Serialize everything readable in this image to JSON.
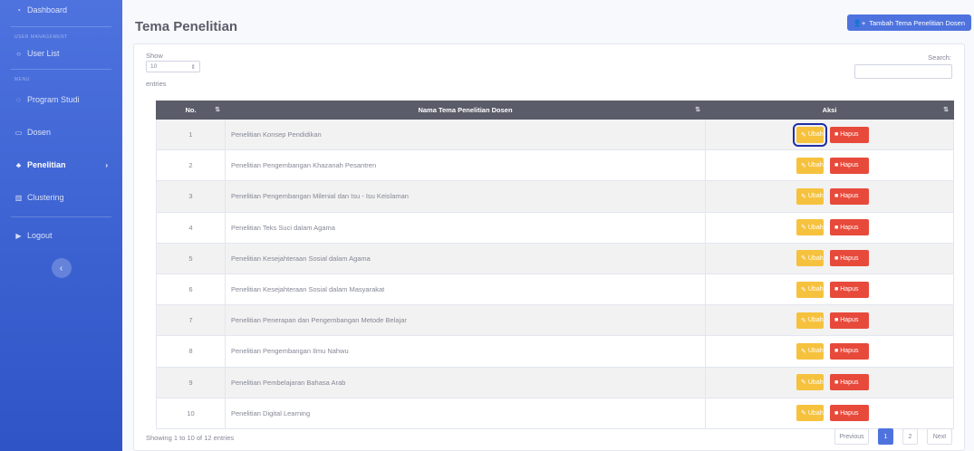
{
  "sidebar": {
    "dashboard": "Dashboard",
    "heading_user": "USER MANAGEMENT",
    "user_list": "User List",
    "heading_menu": "MENU",
    "program_studi": "Program Studi",
    "dosen": "Dosen",
    "penelitian": "Penelitian",
    "clustering": "Clustering",
    "logout": "Logout",
    "toggle": "‹"
  },
  "header": {
    "title": "Tema Penelitian",
    "add_button": "Tambah Tema Penelitian Dosen"
  },
  "table_controls": {
    "show_label": "Show",
    "show_value": "10",
    "entries_label": "entries",
    "search_label": "Search:"
  },
  "table": {
    "columns": [
      "No.",
      "Nama Tema Penelitian Dosen",
      "Aksi"
    ],
    "rows": [
      {
        "no": "1",
        "name": "Penelitian Konsep Pendidikan"
      },
      {
        "no": "2",
        "name": "Penelitian Pengembangan Khazanah Pesantren"
      },
      {
        "no": "3",
        "name": "Penelitian Pengembangan Milenial dan Isu - Isu Keislaman"
      },
      {
        "no": "4",
        "name": "Penelitian Teks Suci dalam Agama"
      },
      {
        "no": "5",
        "name": "Penelitian Kesejahteraan Sosial dalam Agama"
      },
      {
        "no": "6",
        "name": "Penelitian Kesejahteraan Sosial dalam Masyarakat"
      },
      {
        "no": "7",
        "name": "Penelitian Penerapan dan Pengembangan Metode Belajar"
      },
      {
        "no": "8",
        "name": "Penelitian Pengembangan Ilmu Nahwu"
      },
      {
        "no": "9",
        "name": "Penelitian Pembelajaran Bahasa Arab"
      },
      {
        "no": "10",
        "name": "Penelitian Digital Learning"
      }
    ],
    "edit_label": "Ubah",
    "delete_label": "Hapus"
  },
  "footer": {
    "info": "Showing 1 to 10 of 12 entries",
    "previous": "Previous",
    "page1": "1",
    "page2": "2",
    "next": "Next"
  },
  "colors": {
    "sidebar": "#4e73df",
    "edit": "#f6c23e",
    "delete": "#e74a3b",
    "header_row": "#5a5c69"
  }
}
